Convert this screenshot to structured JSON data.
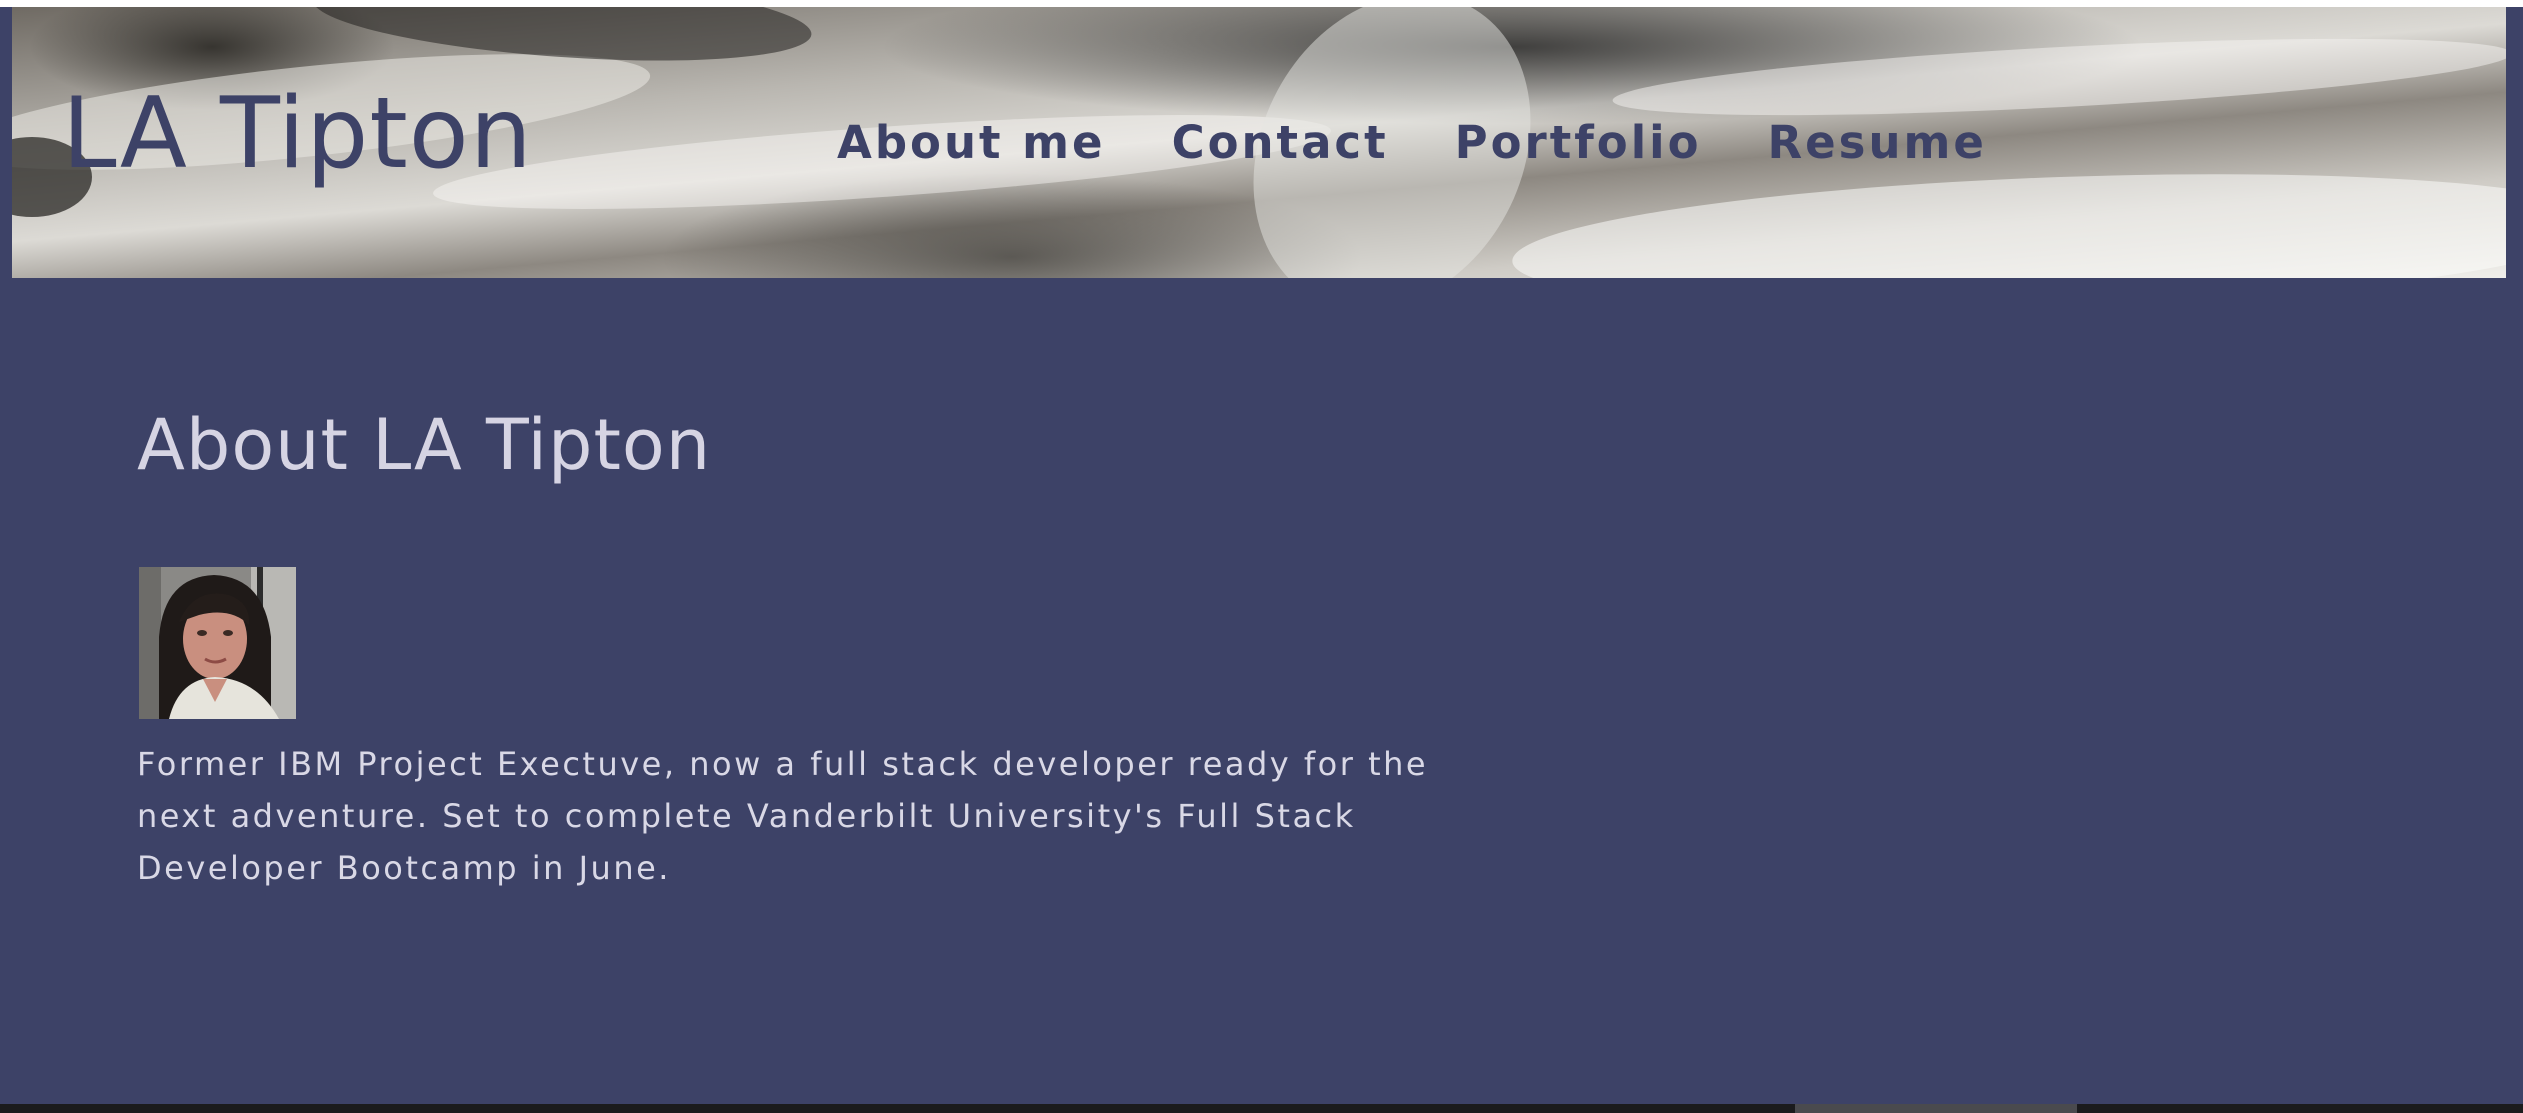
{
  "header": {
    "site_title": "LA Tipton",
    "nav": [
      {
        "label": "About me"
      },
      {
        "label": "Contact"
      },
      {
        "label": "Portfolio"
      },
      {
        "label": "Resume"
      }
    ]
  },
  "main": {
    "heading": "About LA Tipton",
    "bio": "Former IBM Project Exectuve, now a full stack developer ready for the next adventure. Set to complete Vanderbilt University's Full Stack Developer Bootcamp in June."
  },
  "colors": {
    "background": "#3d4267",
    "title_text": "#3d4267",
    "body_text": "#d9d8e6"
  }
}
